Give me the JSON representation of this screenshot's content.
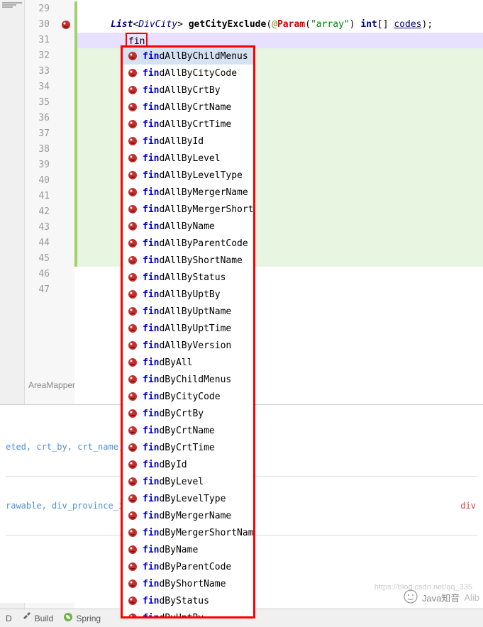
{
  "lines": {
    "start": 29,
    "end": 47
  },
  "code": {
    "line29": "",
    "line30_type": "List",
    "line30_generic": "DivCity",
    "line30_method": "getCityExclude",
    "line30_anno": "@",
    "line30_anno_name": "Param",
    "line30_string": "\"array\"",
    "line30_keyword": "int",
    "line30_brackets": "[]",
    "line30_param": "codes",
    "line31_typed": "fin"
  },
  "breadcrumb": "AreaMapper",
  "autocomplete": {
    "prefix": "fin",
    "items": [
      "findAllByChildMenus",
      "findAllByCityCode",
      "findAllByCrtBy",
      "findAllByCrtName",
      "findAllByCrtTime",
      "findAllById",
      "findAllByLevel",
      "findAllByLevelType",
      "findAllByMergerName",
      "findAllByMergerShortName",
      "findAllByName",
      "findAllByParentCode",
      "findAllByShortName",
      "findAllByStatus",
      "findAllByUptBy",
      "findAllByUptName",
      "findAllByUptTime",
      "findAllByVersion",
      "findByAll",
      "findByChildMenus",
      "findByCityCode",
      "findByCrtBy",
      "findByCrtName",
      "findByCrtTime",
      "findById",
      "findByLevel",
      "findByLevelType",
      "findByMergerName",
      "findByMergerShortName",
      "findByName",
      "findByParentCode",
      "findByShortName",
      "findByStatus",
      "findByUptBy"
    ]
  },
  "console": {
    "line1": "eted, crt_by, crt_name, crt",
    "line2_a": "rawable, div_province_id",
    "line2_b": "div"
  },
  "bottom_tabs": {
    "todo": "D",
    "build": "Build",
    "spring": "Spring"
  },
  "watermark": {
    "text": "Java知音",
    "url": "https://blog.csdn.net/qq_335",
    "suffix": "Alib"
  }
}
